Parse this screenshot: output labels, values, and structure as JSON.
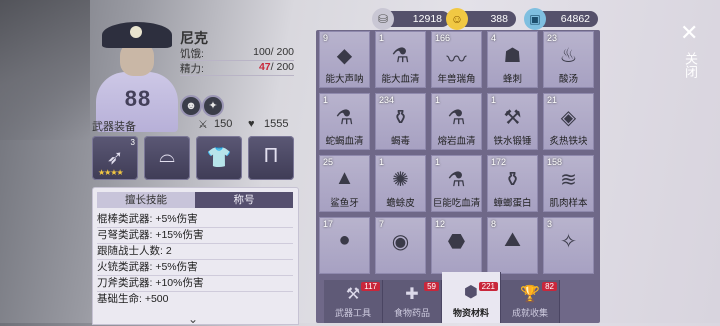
{
  "hero": {
    "name": "尼克",
    "hunger_label": "饥饿:",
    "hunger_value": "100/ 200",
    "energy_label": "精力:",
    "energy_current": "47",
    "energy_max": "/ 200",
    "shirt_number": "88"
  },
  "equipment": {
    "title": "武器装备",
    "attack": "150",
    "health": "1555",
    "slot1_level": "3",
    "slot1_stars": "★★★★"
  },
  "skills": {
    "tab_active": "擅长技能",
    "tab_other": "称号",
    "lines": [
      "棍棒类武器: +5%伤害",
      "弓弩类武器: +15%伤害",
      "跟随战士人数: 2",
      "火铳类武器: +5%伤害",
      "刀斧类武器: +10%伤害",
      "基础生命: +500"
    ]
  },
  "resources": {
    "silver": "12918",
    "coins": "388",
    "tickets": "64862"
  },
  "items": [
    {
      "count": "9",
      "name": "能大声呐",
      "icon": "◆"
    },
    {
      "count": "1",
      "name": "能大血清",
      "icon": "⚗"
    },
    {
      "count": "166",
      "name": "年兽瑞角",
      "icon": "〰"
    },
    {
      "count": "4",
      "name": "蜂刺",
      "icon": "☗"
    },
    {
      "count": "23",
      "name": "酸汤",
      "icon": "♨"
    },
    {
      "count": "1",
      "name": "蛇蝎血清",
      "icon": "⚗"
    },
    {
      "count": "234",
      "name": "蝎毒",
      "icon": "⚱"
    },
    {
      "count": "1",
      "name": "熔岩血清",
      "icon": "⚗"
    },
    {
      "count": "1",
      "name": "铁水锻锤",
      "icon": "⚒"
    },
    {
      "count": "21",
      "name": "炙热铁块",
      "icon": "◈"
    },
    {
      "count": "25",
      "name": "鲨鱼牙",
      "icon": "▲"
    },
    {
      "count": "1",
      "name": "蟾蜍皮",
      "icon": "✺"
    },
    {
      "count": "1",
      "name": "巨能吃血清",
      "icon": "⚗"
    },
    {
      "count": "172",
      "name": "蟑螂蛋白",
      "icon": "⚱"
    },
    {
      "count": "158",
      "name": "肌肉样本",
      "icon": "≋"
    },
    {
      "count": "17",
      "name": "",
      "icon": "●"
    },
    {
      "count": "7",
      "name": "",
      "icon": "◉"
    },
    {
      "count": "12",
      "name": "",
      "icon": "⬣"
    },
    {
      "count": "8",
      "name": "",
      "icon": "⛰"
    },
    {
      "count": "3",
      "name": "",
      "icon": "✧"
    }
  ],
  "bottom_tabs": [
    {
      "label": "武器工具",
      "count": "117",
      "icon": "⚒"
    },
    {
      "label": "食物药品",
      "count": "59",
      "icon": "✚"
    },
    {
      "label": "物资材料",
      "count": "221",
      "icon": "⬢"
    },
    {
      "label": "成就收集",
      "count": "82",
      "icon": "🏆"
    }
  ],
  "close_label": "关闭",
  "colors": {
    "panel": "#6f6888",
    "accent_red": "#c8283a",
    "star": "#f4c842"
  }
}
